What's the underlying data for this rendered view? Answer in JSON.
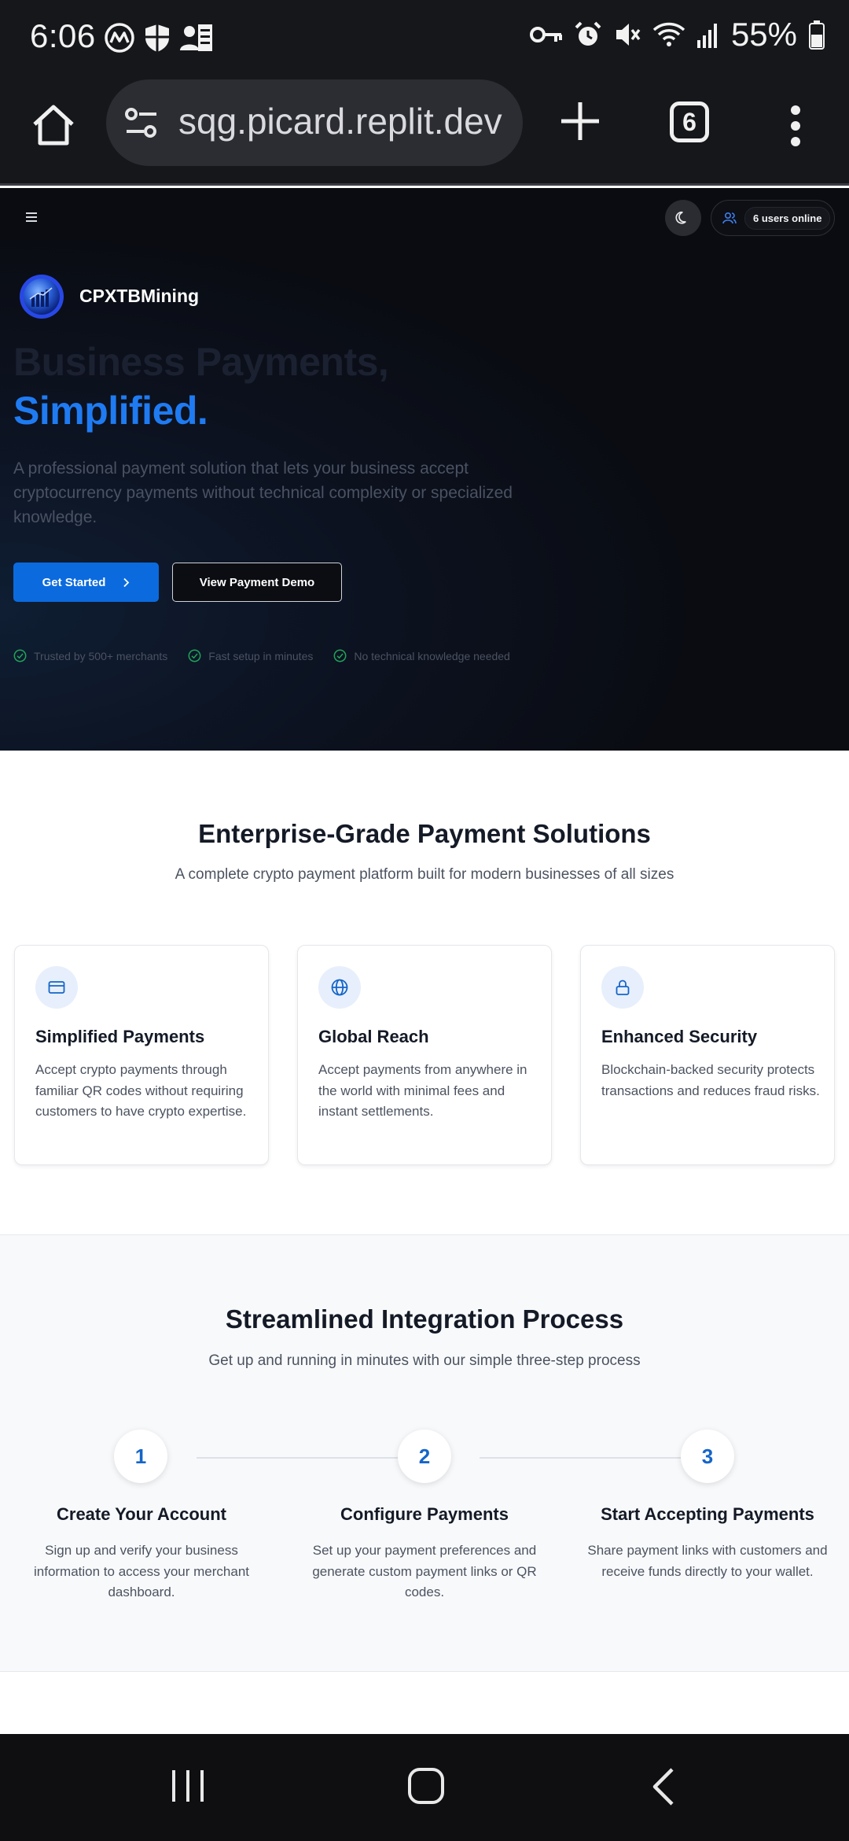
{
  "status_bar": {
    "time": "6:06",
    "battery": "55%",
    "icons": [
      "coinmarketcap-icon",
      "shield-icon",
      "contacts-icon",
      "vpn-key-icon",
      "alarm-icon",
      "mute-icon",
      "wifi-icon",
      "signal-icon",
      "battery-icon"
    ]
  },
  "browser": {
    "url": "sqg.picard.replit.dev",
    "tab_count": "6"
  },
  "hero": {
    "users_online": "6 users online",
    "brand": "CPXTBMining",
    "headline_line1": "Business Payments,",
    "headline_line2": "Simplified.",
    "description": "A professional payment solution that lets your business accept cryptocurrency payments without technical complexity or specialized knowledge.",
    "primary_button": "Get Started",
    "secondary_button": "View Payment Demo",
    "trust": [
      "Trusted by 500+ merchants",
      "Fast setup in minutes",
      "No technical knowledge needed"
    ],
    "colors": {
      "accent": "#1f7bf2",
      "button": "#0b6bde",
      "check": "#22a35a"
    }
  },
  "features": {
    "title": "Enterprise-Grade Payment Solutions",
    "subtitle": "A complete crypto payment platform built for modern businesses of all sizes",
    "cards": [
      {
        "icon": "credit-card-icon",
        "title": "Simplified Payments",
        "text": "Accept crypto payments through familiar QR codes without requiring customers to have crypto expertise."
      },
      {
        "icon": "globe-icon",
        "title": "Global Reach",
        "text": "Accept payments from anywhere in the world with minimal fees and instant settlements."
      },
      {
        "icon": "lock-icon",
        "title": "Enhanced Security",
        "text": "Blockchain-backed security protects transactions and reduces fraud risks."
      }
    ]
  },
  "integration": {
    "title": "Streamlined Integration Process",
    "subtitle": "Get up and running in minutes with our simple three-step process",
    "steps": [
      {
        "number": "1",
        "title": "Create Your Account",
        "text": "Sign up and verify your business information to access your merchant dashboard."
      },
      {
        "number": "2",
        "title": "Configure Payments",
        "text": "Set up your payment preferences and generate custom payment links or QR codes."
      },
      {
        "number": "3",
        "title": "Start Accepting Payments",
        "text": "Share payment links with customers and receive funds directly to your wallet."
      }
    ]
  }
}
